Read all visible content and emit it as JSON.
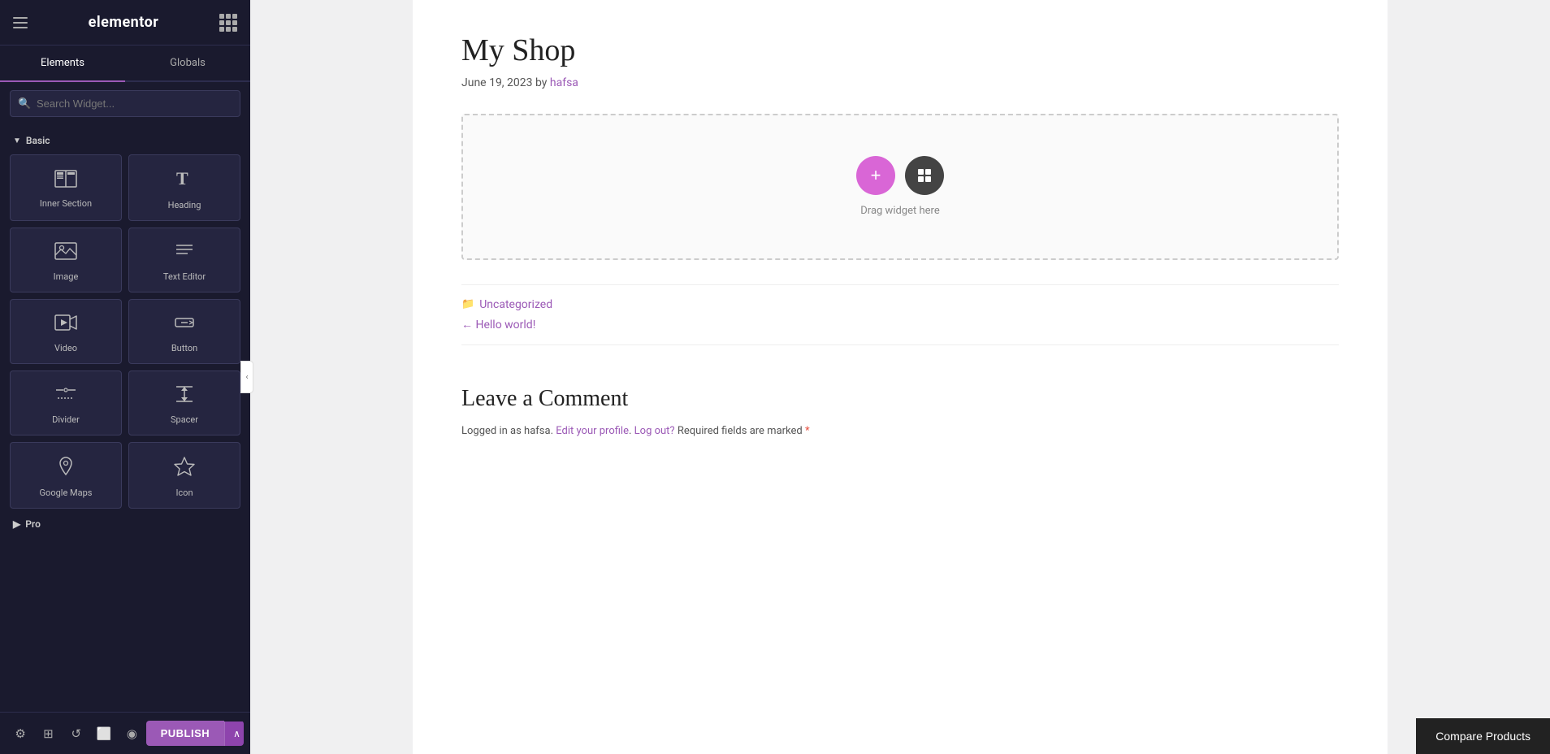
{
  "app": {
    "title": "elementor"
  },
  "panel": {
    "tabs": [
      {
        "id": "elements",
        "label": "Elements",
        "active": true
      },
      {
        "id": "globals",
        "label": "Globals",
        "active": false
      }
    ],
    "search": {
      "placeholder": "Search Widget..."
    },
    "sections": [
      {
        "id": "basic",
        "label": "Basic",
        "expanded": true,
        "widgets": [
          {
            "id": "inner-section",
            "label": "Inner Section",
            "icon": "inner-section-icon"
          },
          {
            "id": "heading",
            "label": "Heading",
            "icon": "heading-icon"
          },
          {
            "id": "image",
            "label": "Image",
            "icon": "image-icon"
          },
          {
            "id": "text-editor",
            "label": "Text Editor",
            "icon": "text-editor-icon"
          },
          {
            "id": "video",
            "label": "Video",
            "icon": "video-icon"
          },
          {
            "id": "button",
            "label": "Button",
            "icon": "button-icon"
          },
          {
            "id": "divider",
            "label": "Divider",
            "icon": "divider-icon"
          },
          {
            "id": "spacer",
            "label": "Spacer",
            "icon": "spacer-icon"
          },
          {
            "id": "google-maps",
            "label": "Google Maps",
            "icon": "google-maps-icon"
          },
          {
            "id": "icon",
            "label": "Icon",
            "icon": "icon-widget-icon"
          }
        ]
      },
      {
        "id": "pro",
        "label": "Pro",
        "expanded": false,
        "widgets": []
      }
    ]
  },
  "toolbar": {
    "settings_label": "⚙",
    "layers_label": "⊞",
    "history_label": "↺",
    "responsive_label": "⬜",
    "preview_label": "◉",
    "publish_label": "PUBLISH",
    "chevron_label": "∧"
  },
  "canvas": {
    "post_title": "My Shop",
    "post_meta": "June 19, 2023 by",
    "post_author": "hafsa",
    "drop_zone": {
      "hint": "Drag widget here"
    },
    "post_footer": {
      "categories_label": "",
      "category": "Uncategorized",
      "nav_prev": "← Hello world!"
    },
    "comments": {
      "title": "Leave a Comment",
      "logged_in_text": "Logged in as hafsa.",
      "edit_profile": "Edit your profile",
      "logout": "Log out?",
      "required_text": "Required fields are marked",
      "asterisk": "*"
    }
  },
  "footer": {
    "compare_products": "Compare Products"
  }
}
